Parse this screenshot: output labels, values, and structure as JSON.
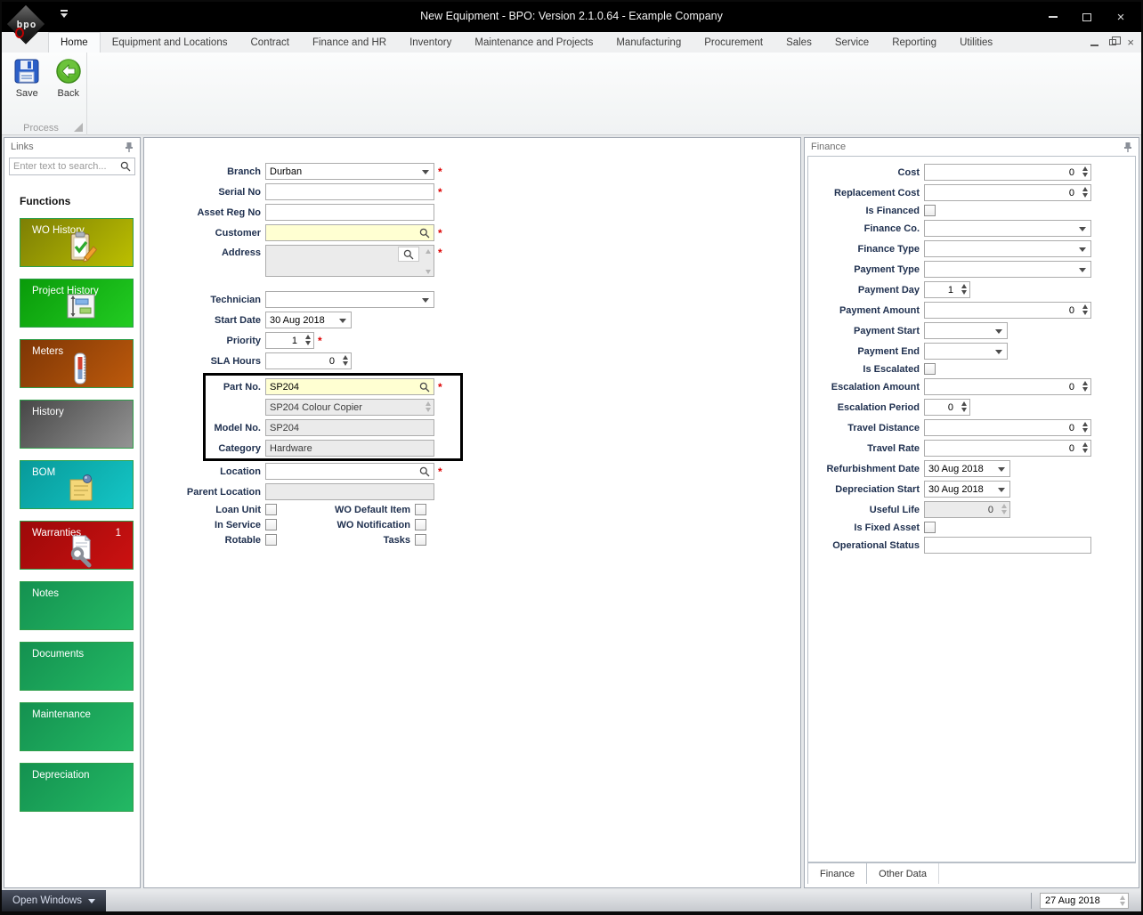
{
  "window": {
    "title": "New Equipment - BPO: Version 2.1.0.64 - Example Company",
    "logo_text": "bpo"
  },
  "ribbon": {
    "tabs": [
      {
        "label": "Home",
        "selected": true
      },
      {
        "label": "Equipment and Locations"
      },
      {
        "label": "Contract"
      },
      {
        "label": "Finance and HR"
      },
      {
        "label": "Inventory"
      },
      {
        "label": "Maintenance and Projects"
      },
      {
        "label": "Manufacturing"
      },
      {
        "label": "Procurement"
      },
      {
        "label": "Sales"
      },
      {
        "label": "Service"
      },
      {
        "label": "Reporting"
      },
      {
        "label": "Utilities"
      }
    ],
    "buttons": [
      {
        "label": "Save",
        "icon": "save-floppy-icon"
      },
      {
        "label": "Back",
        "icon": "back-arrow-icon"
      }
    ],
    "group_label": "Process"
  },
  "links_panel": {
    "title": "Links",
    "search_placeholder": "Enter text to search...",
    "section_title": "Functions",
    "buttons": [
      {
        "label": "WO History",
        "icon": "clipboard-pencil-icon",
        "color_from": "#7d7f05",
        "color_to": "#bcbf00"
      },
      {
        "label": "Project History",
        "icon": "gantt-chart-icon",
        "color_from": "#0a9b0a",
        "color_to": "#22cc22"
      },
      {
        "label": "Meters",
        "icon": "thermometer-icon",
        "color_from": "#7e3605",
        "color_to": "#bd5a0c"
      },
      {
        "label": "History",
        "icon": "",
        "color_from": "#474747",
        "color_to": "#949494"
      },
      {
        "label": "BOM",
        "icon": "note-pin-icon",
        "color_from": "#089a9a",
        "color_to": "#14c6c6"
      },
      {
        "label": "Warranties",
        "icon": "wrench-document-icon",
        "badge": "1",
        "color_from": "#9c0909",
        "color_to": "#cc1111"
      },
      {
        "label": "Notes",
        "icon": "",
        "color_from": "#149150",
        "color_to": "#23b964"
      },
      {
        "label": "Documents",
        "icon": "",
        "color_from": "#149150",
        "color_to": "#23b964"
      },
      {
        "label": "Maintenance",
        "icon": "",
        "color_from": "#149150",
        "color_to": "#23b964"
      },
      {
        "label": "Depreciation",
        "icon": "",
        "color_from": "#149150",
        "color_to": "#23b964"
      }
    ]
  },
  "form": {
    "required_marker": "*",
    "rows": [
      {
        "label": "Branch",
        "value": "Durban",
        "type": "dropdown",
        "required": true
      },
      {
        "label": "Serial No",
        "value": "",
        "type": "text",
        "required": true
      },
      {
        "label": "Asset Reg No",
        "value": "",
        "type": "text"
      },
      {
        "label": "Customer",
        "value": "",
        "type": "lookup",
        "required": true
      },
      {
        "label": "Address",
        "value": "",
        "type": "address",
        "required": true
      },
      {
        "label": "Technician",
        "value": "",
        "type": "dropdown"
      },
      {
        "label": "Start Date",
        "value": "30 Aug 2018",
        "type": "date"
      },
      {
        "label": "Priority",
        "value": "1",
        "type": "spinner",
        "required": true
      },
      {
        "label": "SLA Hours",
        "value": "0",
        "type": "spinner"
      },
      {
        "label": "Part No.",
        "value": "SP204",
        "type": "lookup",
        "required": true
      },
      {
        "label": "",
        "value": "SP204 Colour Copier",
        "type": "readonly"
      },
      {
        "label": "Model No.",
        "value": "SP204",
        "type": "readonly"
      },
      {
        "label": "Category",
        "value": "Hardware",
        "type": "readonly"
      },
      {
        "label": "Location",
        "value": "",
        "type": "lookup",
        "required": true
      },
      {
        "label": "Parent Location",
        "value": "",
        "type": "readonly"
      }
    ],
    "check_rows": [
      {
        "left": "Loan Unit",
        "right": "WO Default Item"
      },
      {
        "left": "In Service",
        "right": "WO Notification"
      },
      {
        "left": "Rotable",
        "right": "Tasks"
      }
    ]
  },
  "finance_panel": {
    "title": "Finance",
    "rows": [
      {
        "label": "Cost",
        "value": "0",
        "type": "number"
      },
      {
        "label": "Replacement Cost",
        "value": "0",
        "type": "number"
      },
      {
        "label": "Is Financed",
        "value": "unchecked",
        "type": "checkbox"
      },
      {
        "label": "Finance Co.",
        "value": "",
        "type": "dropdown"
      },
      {
        "label": "Finance Type",
        "value": "",
        "type": "dropdown"
      },
      {
        "label": "Payment Type",
        "value": "",
        "type": "dropdown"
      },
      {
        "label": "Payment Day",
        "value": "1",
        "type": "spinner"
      },
      {
        "label": "Payment Amount",
        "value": "0",
        "type": "number"
      },
      {
        "label": "Payment Start",
        "value": "",
        "type": "dropdown"
      },
      {
        "label": "Payment End",
        "value": "",
        "type": "dropdown"
      },
      {
        "label": "Is Escalated",
        "value": "unchecked",
        "type": "checkbox"
      },
      {
        "label": "Escalation Amount",
        "value": "0",
        "type": "number"
      },
      {
        "label": "Escalation Period",
        "value": "0",
        "type": "spinner"
      },
      {
        "label": "Travel Distance",
        "value": "0",
        "type": "number"
      },
      {
        "label": "Travel Rate",
        "value": "0",
        "type": "number"
      },
      {
        "label": "Refurbishment Date",
        "value": "30 Aug 2018",
        "type": "date"
      },
      {
        "label": "Depreciation Start",
        "value": "30 Aug 2018",
        "type": "date"
      },
      {
        "label": "Useful Life",
        "value": "0",
        "type": "readonly-spinner"
      },
      {
        "label": "Is Fixed Asset",
        "value": "unchecked",
        "type": "checkbox"
      },
      {
        "label": "Operational Status",
        "value": "",
        "type": "text"
      }
    ],
    "tabs": [
      {
        "label": "Finance",
        "selected": true
      },
      {
        "label": "Other Data"
      }
    ]
  },
  "statusbar": {
    "open_windows_label": "Open Windows",
    "date": "27 Aug 2018"
  }
}
